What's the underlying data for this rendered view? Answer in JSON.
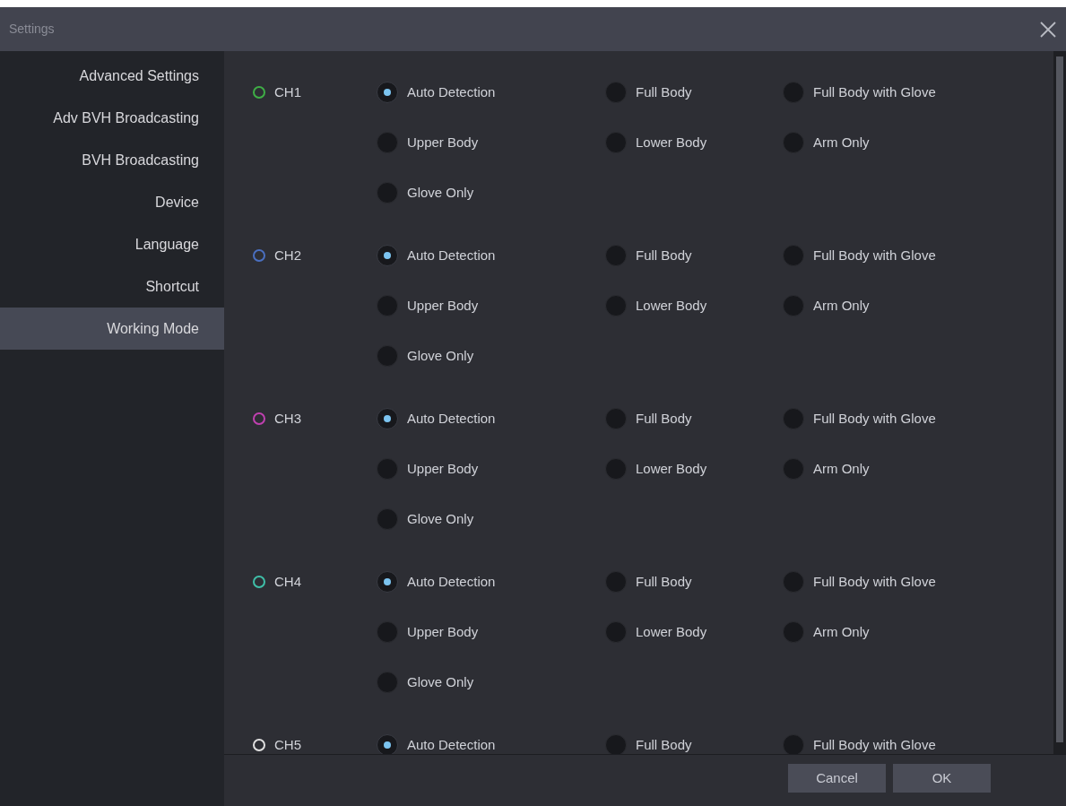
{
  "window": {
    "title": "Settings"
  },
  "sidebar": {
    "items": [
      {
        "label": "Advanced Settings",
        "selected": false
      },
      {
        "label": "Adv BVH Broadcasting",
        "selected": false
      },
      {
        "label": "BVH Broadcasting",
        "selected": false
      },
      {
        "label": "Device",
        "selected": false
      },
      {
        "label": "Language",
        "selected": false
      },
      {
        "label": "Shortcut",
        "selected": false
      },
      {
        "label": "Working Mode",
        "selected": true
      }
    ]
  },
  "channels": [
    {
      "name": "CH1",
      "color": "#3fae46",
      "options": [
        {
          "label": "Auto Detection",
          "selected": true
        },
        {
          "label": "Full Body",
          "selected": false
        },
        {
          "label": "Full Body with Glove",
          "selected": false
        },
        {
          "label": "Upper Body",
          "selected": false
        },
        {
          "label": "Lower Body",
          "selected": false
        },
        {
          "label": "Arm Only",
          "selected": false
        },
        {
          "label": "Glove Only",
          "selected": false
        }
      ]
    },
    {
      "name": "CH2",
      "color": "#4a6fc0",
      "options": [
        {
          "label": "Auto Detection",
          "selected": true
        },
        {
          "label": "Full Body",
          "selected": false
        },
        {
          "label": "Full Body with Glove",
          "selected": false
        },
        {
          "label": "Upper Body",
          "selected": false
        },
        {
          "label": "Lower Body",
          "selected": false
        },
        {
          "label": "Arm Only",
          "selected": false
        },
        {
          "label": "Glove Only",
          "selected": false
        }
      ]
    },
    {
      "name": "CH3",
      "color": "#c040b0",
      "options": [
        {
          "label": "Auto Detection",
          "selected": true
        },
        {
          "label": "Full Body",
          "selected": false
        },
        {
          "label": "Full Body with Glove",
          "selected": false
        },
        {
          "label": "Upper Body",
          "selected": false
        },
        {
          "label": "Lower Body",
          "selected": false
        },
        {
          "label": "Arm Only",
          "selected": false
        },
        {
          "label": "Glove Only",
          "selected": false
        }
      ]
    },
    {
      "name": "CH4",
      "color": "#3fbfa8",
      "options": [
        {
          "label": "Auto Detection",
          "selected": true
        },
        {
          "label": "Full Body",
          "selected": false
        },
        {
          "label": "Full Body with Glove",
          "selected": false
        },
        {
          "label": "Upper Body",
          "selected": false
        },
        {
          "label": "Lower Body",
          "selected": false
        },
        {
          "label": "Arm Only",
          "selected": false
        },
        {
          "label": "Glove Only",
          "selected": false
        }
      ]
    },
    {
      "name": "CH5",
      "color": "#e0e0e0",
      "options": [
        {
          "label": "Auto Detection",
          "selected": true
        },
        {
          "label": "Full Body",
          "selected": false
        },
        {
          "label": "Full Body with Glove",
          "selected": false
        }
      ]
    }
  ],
  "buttons": [
    {
      "label": "Cancel"
    },
    {
      "label": "OK"
    }
  ]
}
